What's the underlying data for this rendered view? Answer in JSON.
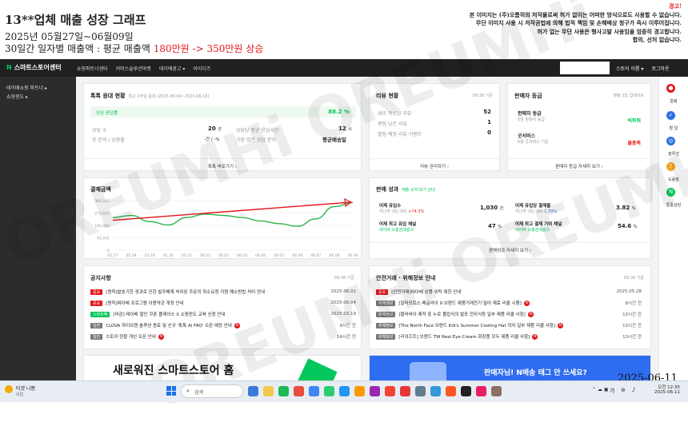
{
  "header": {
    "title": "13**업체 매출 성장 그래프",
    "period": "2025년 05월27일~06월09일",
    "desc_prefix": "30일간 일자별 매출액 : 평균 매출액 ",
    "desc_highlight": "180만원 -> 350만원 상승"
  },
  "notice": {
    "warning": "경고!",
    "line1": "본 이미지는 (주)오름히의 저작물로써 허가 없이는 어떠한 방식으로도 사용할 수 없습니다.",
    "line2": "무단 이미지 사용 시 저작권법에 의해 법적 책임 및 손해배상 청구가 즉시 이루어집니다.",
    "line3": "허가 없는 무단 사용은 형사고발 사용임을 엄중히 경고합니다.",
    "line4": "합의, 선처 없습니다."
  },
  "watermark": "OREUMHi OREUMHi",
  "nav": {
    "logo": "스마트스토어센터",
    "menu": [
      "쇼핑파트너센터",
      "커머스솔루션마켓",
      "테이배광고 ▾",
      "아이디즈"
    ],
    "right": [
      "스토어 이름 ▾",
      "로그아웃"
    ]
  },
  "sidebar": {
    "items": [
      "테이배쇼핑 파트너 ▸",
      "쇼핑윈도 ▸"
    ]
  },
  "right_rail": [
    {
      "label": "알림",
      "icon": "bell-icon",
      "color": "#e4161a"
    },
    {
      "label": "할 일",
      "icon": "check-icon",
      "color": "#2b6fe0"
    },
    {
      "label": "솔루션",
      "icon": "solution-icon",
      "color": "#2b6fe0"
    },
    {
      "label": "도움말",
      "icon": "help-icon",
      "color": "#f5a623"
    },
    {
      "label": "통통상담",
      "icon": "chat-icon",
      "color": "#03c75a"
    }
  ],
  "order_status": {
    "title": "톡톡 응대 현황",
    "sub": "최근 1주일 응대 (2025.06.04~2025.06.10)",
    "rate_label": "상담 응답률",
    "rate_value": "88.2 %",
    "r1_label": "상담 수",
    "r1_value": "20",
    "r1_unit": "건",
    "r1b_label": "상담당 평균 응답시간",
    "r1b_value": "12",
    "r1b_unit": "시",
    "r2_label": "응 문의 / 상품출",
    "r2_value": "-건 / -%",
    "r2b_label": "가장 많은 상담 분야",
    "r2b_value": "평균배송일",
    "footer": "톡톡 바로가기 ›"
  },
  "review": {
    "title": "리뷰 현황",
    "time": "09:38 기준",
    "rows": [
      {
        "label": "새로 작성된 리뷰",
        "value": "52"
      },
      {
        "label": "평점 낮은 리뷰",
        "value": "1"
      },
      {
        "label": "별점 예정 리뷰 이벤트",
        "value": "0"
      }
    ],
    "footer": "리뷰 관리하기 ›"
  },
  "grade": {
    "title": "판매자 등급",
    "note": "매월 2일 업데이트",
    "r1_label": "판매자 등급",
    "r1_sub": "6월 판매자 등급",
    "r1_value": "빅파워",
    "r2_label": "굿서비스",
    "r2_sub": "6월 굿서비스 기준",
    "r2_value": "불충족",
    "footer": "판매자 등급 자세히 보기 ›"
  },
  "payment_chart": {
    "title": "결제금액"
  },
  "chart_data": {
    "type": "line",
    "title": "결제금액",
    "categories": [
      "05.27",
      "05.28",
      "05.29",
      "05.30",
      "05.31",
      "06.01",
      "06.02",
      "06.03",
      "06.04",
      "06.05",
      "06.06",
      "06.07",
      "06.08",
      "06.09"
    ],
    "y_ticks": [
      "364,167",
      "273,625",
      "182,083",
      "91,541",
      "0"
    ],
    "ylim": [
      0,
      364167
    ],
    "series": [
      {
        "values": [
          240000,
          255000,
          210000,
          185000,
          240000,
          265000,
          255000,
          240000,
          215000,
          195000,
          175000,
          230000,
          320000,
          350000
        ],
        "color": "#2db34a"
      }
    ],
    "trend_arrow_color": "#e4161a",
    "grid": true
  },
  "performance": {
    "title": "판매 성과",
    "sub": "매출 요약 보기 안내",
    "r1a_label": "어제 유입수",
    "r1a_sub": "지난주 (목) 대비",
    "r1a_change": "+74.3%",
    "r1a_value": "1,030",
    "r1a_unit": "건",
    "r1b_label": "어제 유입당 결제율",
    "r1b_sub": "지난주 (목) 대비",
    "r1b_change": "1.70%",
    "r1b_value": "3.82",
    "r1b_unit": "%",
    "r2a_label": "어제 최고 유입 채널",
    "r2a_sub": "네이버 쇼핑검색광고",
    "r2a_value": "47",
    "r2a_unit": "%",
    "r2b_label": "어제 최고 결제 기여 채널",
    "r2b_sub": "네이버 쇼핑검색광고",
    "r2b_value": "54.6",
    "r2b_unit": "%",
    "footer": "판매성과 자세히 보기 ›"
  },
  "notices": {
    "title": "공지사항",
    "time": "09:38 기준",
    "items": [
      {
        "tag": "중요",
        "tagcolor": "#e4161a",
        "text": "[원칙]발송기한 경과로 인한 발주해제 처리된 주문의 취소요청 지원 해소방법 처리 안내",
        "date": "2025.06.01",
        "new": false
      },
      {
        "tag": "중요",
        "tagcolor": "#e4161a",
        "text": "[원칙]테이배 프로그램 이용약관 개정 안내",
        "date": "2025.06.04",
        "new": false
      },
      {
        "tag": "스마트팩",
        "tagcolor": "#03c75a",
        "text": "[마감] 테이배 할인 쿠폰 플레이스 X 쇼핑윈도 교육 신청 안내",
        "date": "2025.03.19",
        "new": false
      },
      {
        "tag": "일반",
        "tagcolor": "#777777",
        "text": "CLOVA 하이브렌 솔루션 종료 및 신규 '톡톡 AI FAQ' 오픈 예정 안내",
        "date": "8시간 전",
        "new": true
      },
      {
        "tag": "일반",
        "tagcolor": "#777777",
        "text": "스토어 현황 개선 오픈 안내",
        "date": "14시간 전",
        "new": true
      }
    ]
  },
  "safety": {
    "title": "안전거래 · 위해정보 안내",
    "time": "09:38 기준",
    "items": [
      {
        "tag": "중요",
        "tagcolor": "#e4161a",
        "text": "[안전거래]테이배 상품 위탁 제한 안내",
        "date": "2025.05.28",
        "new": false
      },
      {
        "tag": "위해정보",
        "tagcolor": "#777777",
        "text": "[알터모트스 패글라이 9 브랜드 제품거래전기 밀어 재료 리콜 시행]",
        "date": "8시간 전",
        "new": true
      },
      {
        "tag": "위해정보",
        "tagcolor": "#777777",
        "text": "[블러바이 제작 중 누로 폴립식의 발포 전자식등 일부 제품 리콜 사항]",
        "date": "13시간 전",
        "new": true
      },
      {
        "tag": "위해정보",
        "tagcolor": "#777777",
        "text": "[The North Face 브랜드 Kid's Summer Cooling Hat 의자 일부 제품 리콜 사항]",
        "date": "13시간 전",
        "new": true
      },
      {
        "tag": "위해정보",
        "tagcolor": "#777777",
        "text": "[리이즈트] 브랜드 TW Real Eye Cream 화장품 모두 제품 리콜 사항]",
        "date": "13시간 전",
        "new": true
      }
    ]
  },
  "banner_left": "새로워진 스마트스토어 홈",
  "banner_right": "판매자님! N배송 태그 안 쓰세요?",
  "date_stamp": "2025-06-11",
  "taskbar": {
    "weather_temp": "타겟 나쁨",
    "weather_sub": "내일",
    "search_placeholder": "검색",
    "lang": "가",
    "time": "오전 12:35",
    "date": "2025-06-11"
  }
}
